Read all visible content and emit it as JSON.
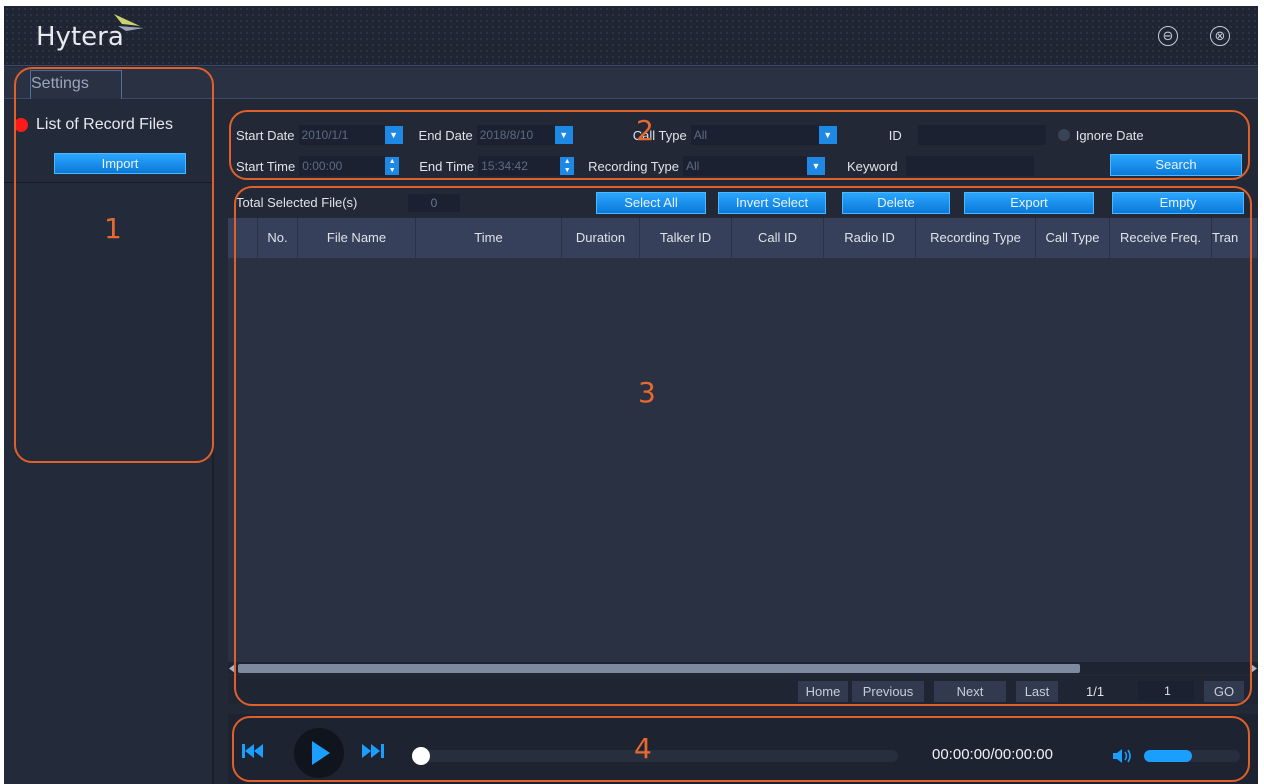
{
  "app": {
    "logo": "Hytera"
  },
  "window": {
    "minimize_glyph": "⊖",
    "close_glyph": "⊗"
  },
  "tabs": [
    {
      "label": "Settings"
    }
  ],
  "sidebar": {
    "title": "List of Record Files",
    "import_label": "Import"
  },
  "filters": {
    "start_date_label": "Start Date",
    "start_date_value": "2010/1/1",
    "end_date_label": "End Date",
    "end_date_value": "2018/8/10",
    "call_type_label": "Call Type",
    "call_type_value": "All",
    "id_label": "ID",
    "id_value": "",
    "ignore_date_label": "Ignore Date",
    "start_time_label": "Start Time",
    "start_time_value": "0:00:00",
    "end_time_label": "End Time",
    "end_time_value": "15:34:42",
    "recording_type_label": "Recording Type",
    "recording_type_value": "All",
    "keyword_label": "Keyword",
    "keyword_value": "",
    "search_label": "Search"
  },
  "toolbar": {
    "total_selected_label": "Total Selected File(s)",
    "total_selected_value": "0",
    "select_all": "Select All",
    "invert_select": "Invert Select",
    "delete": "Delete",
    "export": "Export",
    "empty": "Empty"
  },
  "table": {
    "columns": [
      "No.",
      "File Name",
      "Time",
      "Duration",
      "Talker ID",
      "Call ID",
      "Radio ID",
      "Recording Type",
      "Call Type",
      "Receive Freq.",
      "Tran"
    ],
    "rows": []
  },
  "pager": {
    "home": "Home",
    "previous": "Previous",
    "next": "Next",
    "last": "Last",
    "page_info": "1/1",
    "page_input": "1",
    "go": "GO"
  },
  "player": {
    "time": "00:00:00/00:00:00",
    "progress": 0,
    "volume": 0.5
  },
  "annotations": [
    "1",
    "2",
    "3",
    "4"
  ],
  "colors": {
    "accent": "#1e88e5",
    "annotation": "#e0602a",
    "record_dot": "#ff1a1a"
  }
}
